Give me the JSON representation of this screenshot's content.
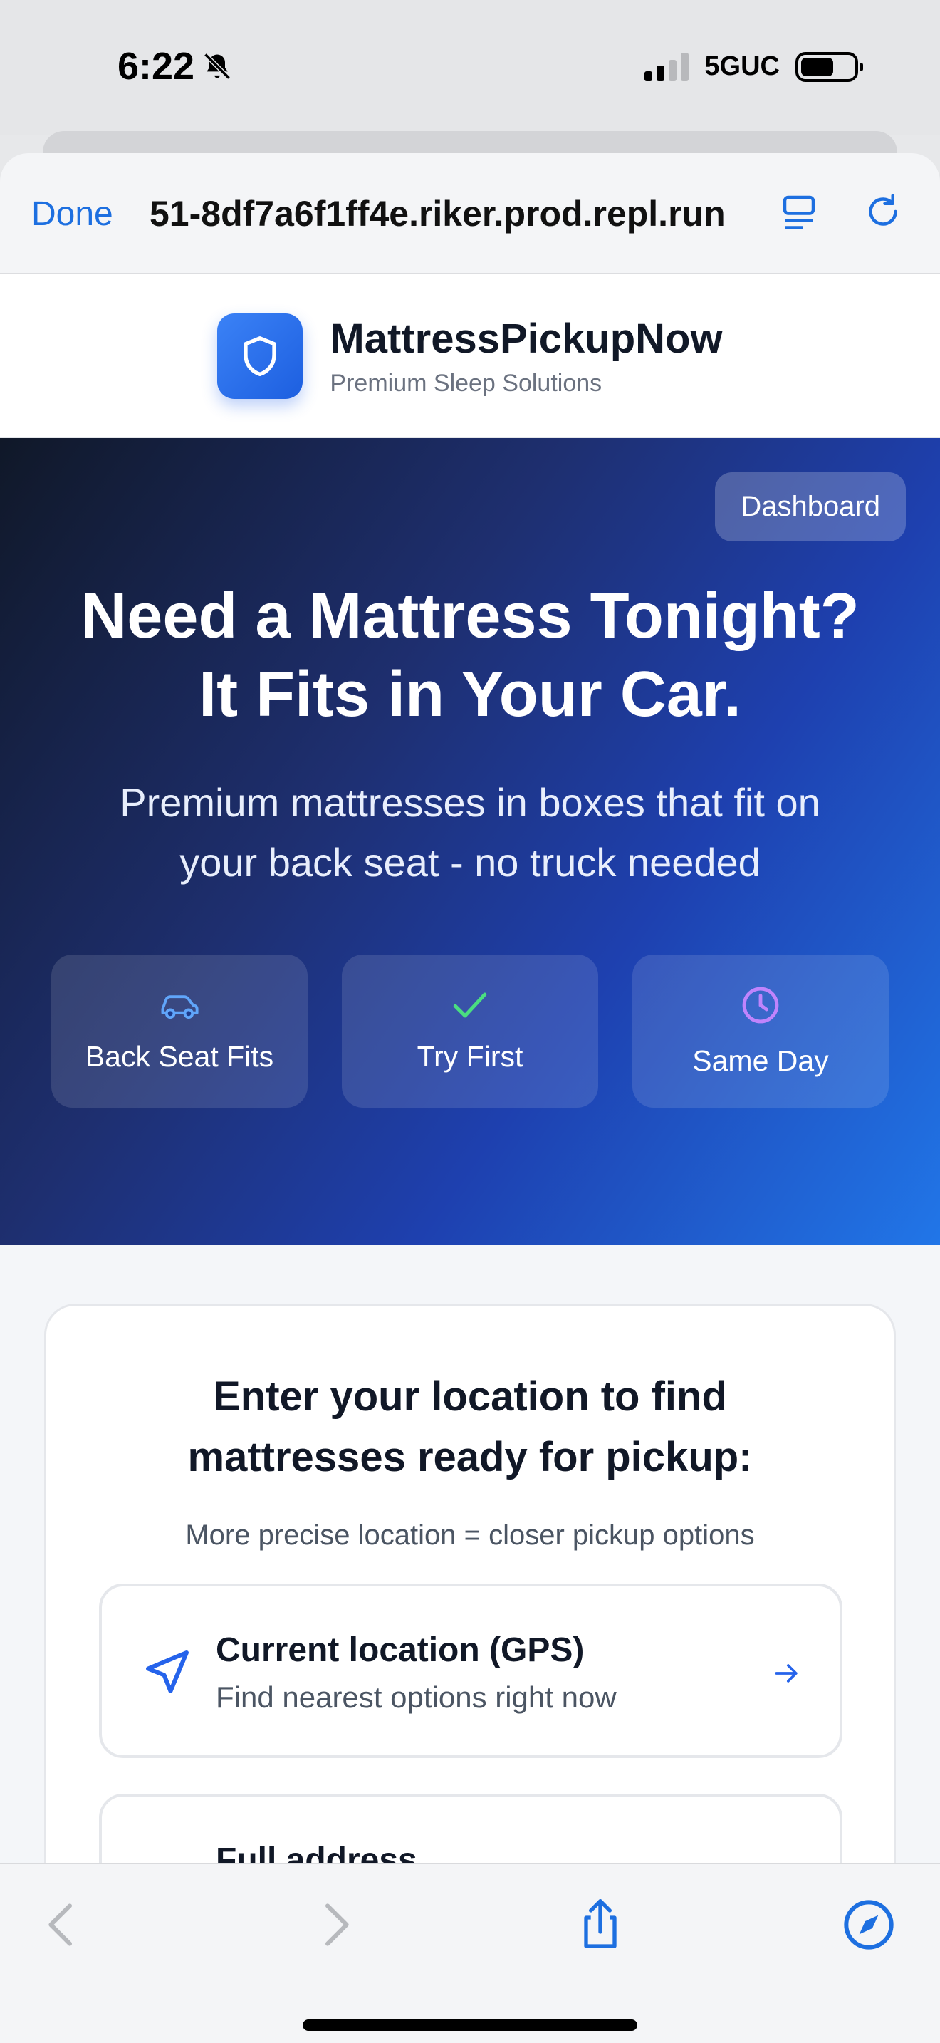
{
  "status_bar": {
    "time": "6:22",
    "network": "5GUC"
  },
  "browser": {
    "done_label": "Done",
    "url": "51-8df7a6f1ff4e.riker.prod.repl.run"
  },
  "header": {
    "brand_name": "MattressPickupNow",
    "brand_tagline": "Premium Sleep Solutions",
    "icon": "shield-icon"
  },
  "hero": {
    "dashboard_label": "Dashboard",
    "title_line1": "Need a Mattress Tonight?",
    "title_line2": "It Fits in Your Car.",
    "subtitle_line1": "Premium mattresses in boxes that fit on",
    "subtitle_line2": "your back seat - no truck needed",
    "features": [
      {
        "label": "Back Seat Fits",
        "icon": "car-icon",
        "color": "#60a5fa"
      },
      {
        "label": "Try First",
        "icon": "check-icon",
        "color": "#4ade80"
      },
      {
        "label": "Same Day",
        "icon": "clock-icon",
        "color": "#c084fc"
      }
    ]
  },
  "location": {
    "title_line1": "Enter your location to find",
    "title_line2": "mattresses ready for pickup:",
    "hint": "More precise location = closer pickup options",
    "options": [
      {
        "title": "Current location (GPS)",
        "subtitle": "Find nearest options right now",
        "icon": "navigation-arrow-icon"
      },
      {
        "title": "Full address",
        "subtitle": "",
        "icon": ""
      }
    ]
  },
  "colors": {
    "accent": "#1d6fe0",
    "hero_start": "#101828",
    "hero_end": "#2176e8"
  }
}
